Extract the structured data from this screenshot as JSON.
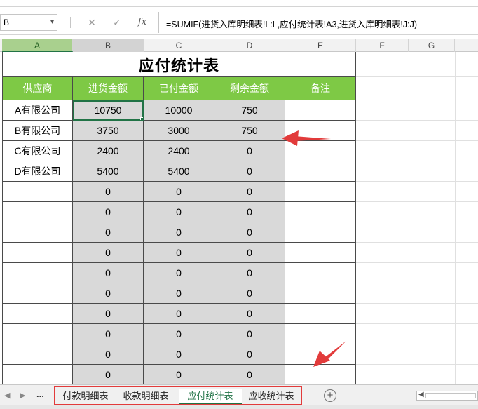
{
  "formula_bar": {
    "name_box": "B",
    "cancel_icon": "close-icon",
    "enter_icon": "check-icon",
    "fx_label": "fx",
    "formula": "=SUMIF(进货入库明细表!L:L,应付统计表!A3,进货入库明细表!J:J)"
  },
  "columns": [
    "A",
    "B",
    "C",
    "D",
    "E",
    "F",
    "G"
  ],
  "sheet": {
    "title": "应付统计表",
    "headers": [
      "供应商",
      "进货金额",
      "已付金额",
      "剩余金额",
      "备注"
    ],
    "rows": [
      [
        "A有限公司",
        "10750",
        "10000",
        "750",
        ""
      ],
      [
        "B有限公司",
        "3750",
        "3000",
        "750",
        ""
      ],
      [
        "C有限公司",
        "2400",
        "2400",
        "0",
        ""
      ],
      [
        "D有限公司",
        "5400",
        "5400",
        "0",
        ""
      ],
      [
        "",
        "0",
        "0",
        "0",
        ""
      ],
      [
        "",
        "0",
        "0",
        "0",
        ""
      ],
      [
        "",
        "0",
        "0",
        "0",
        ""
      ],
      [
        "",
        "0",
        "0",
        "0",
        ""
      ],
      [
        "",
        "0",
        "0",
        "0",
        ""
      ],
      [
        "",
        "0",
        "0",
        "0",
        ""
      ],
      [
        "",
        "0",
        "0",
        "0",
        ""
      ],
      [
        "",
        "0",
        "0",
        "0",
        ""
      ],
      [
        "",
        "0",
        "0",
        "0",
        ""
      ],
      [
        "",
        "0",
        "0",
        "0",
        ""
      ]
    ]
  },
  "tabbar": {
    "nav_more": "...",
    "tabs": [
      "付款明细表",
      "收款明细表",
      "应付统计表",
      "应收统计表"
    ],
    "active_tab": "应付统计表",
    "add_icon": "plus-circle-icon"
  },
  "colors": {
    "header_green": "#7ec945",
    "accent": "#217346",
    "annotation_red": "#e23b3b",
    "calc_gray": "#d9d9d9"
  }
}
